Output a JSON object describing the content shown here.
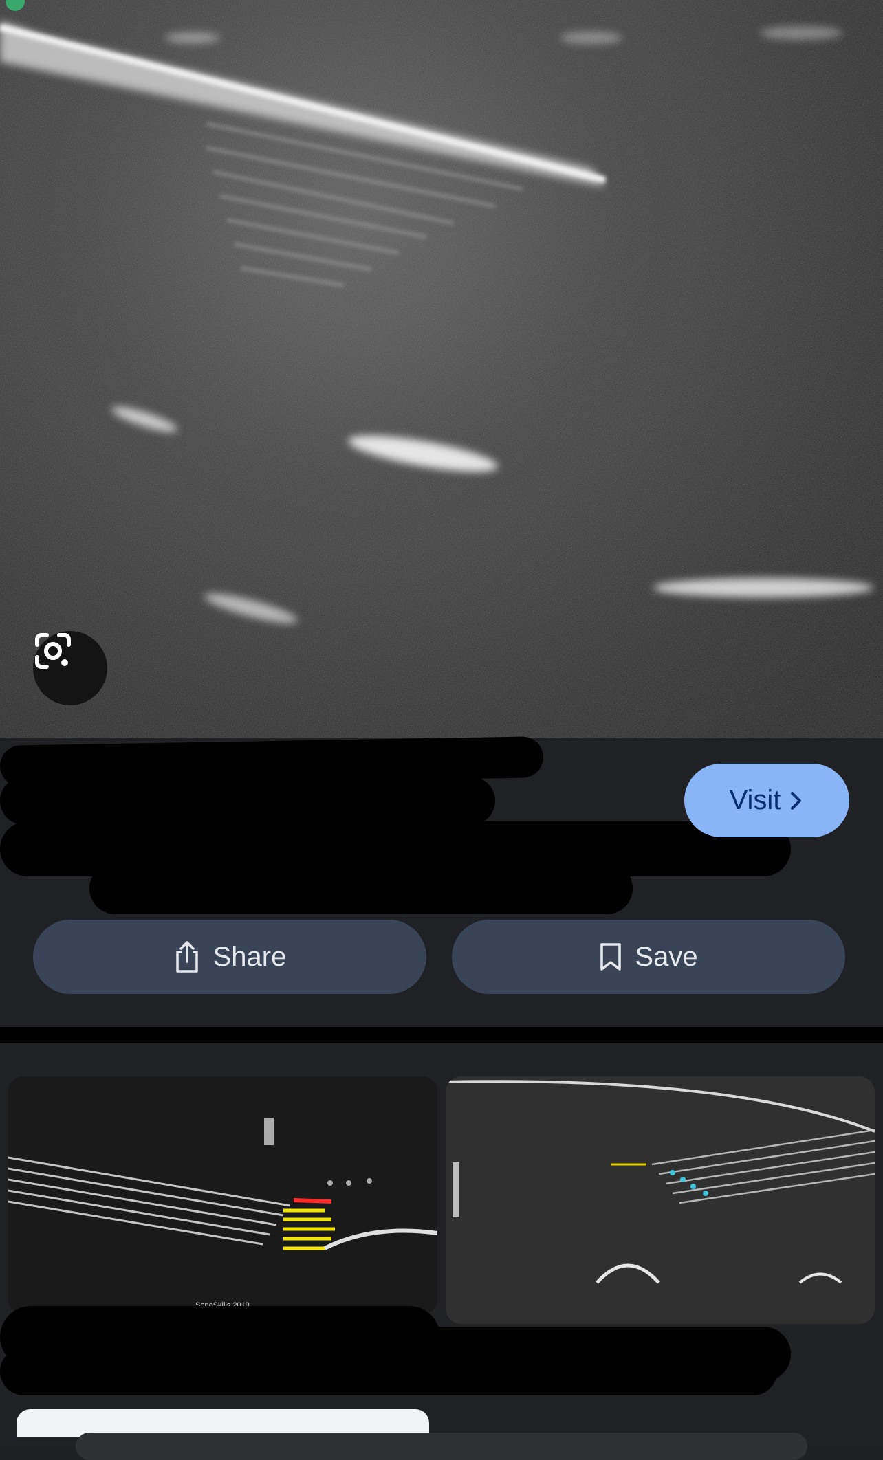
{
  "hero": {
    "lens_icon": "google-lens-icon",
    "status_dot_color": "#3aa76d"
  },
  "result": {
    "visit_label": "Visit",
    "visit_icon": "chevron-right-icon"
  },
  "actions": {
    "share_label": "Share",
    "share_icon": "share-icon",
    "save_label": "Save",
    "save_icon": "bookmark-icon"
  },
  "related": {
    "thumb_1": {
      "caption": "SonoSkills 2019"
    }
  },
  "colors": {
    "accent": "#8ab4f8",
    "button_bg": "#394457",
    "background": "#202124"
  }
}
